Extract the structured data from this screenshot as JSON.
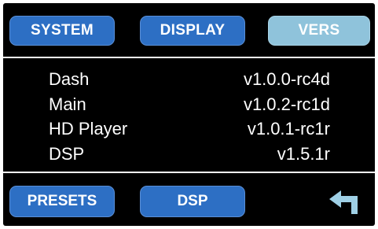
{
  "tabs": [
    {
      "label": "SYSTEM",
      "active": false
    },
    {
      "label": "DISPLAY",
      "active": false
    },
    {
      "label": "VERS",
      "active": true
    }
  ],
  "versions": [
    {
      "name": "Dash",
      "value": "v1.0.0-rc4d"
    },
    {
      "name": "Main",
      "value": "v1.0.2-rc1d"
    },
    {
      "name": "HD Player",
      "value": "v1.0.1-rc1r"
    },
    {
      "name": "DSP",
      "value": "v1.5.1r"
    }
  ],
  "bottom_bar": {
    "presets_label": "PRESETS",
    "dsp_label": "DSP",
    "back_icon": "return-arrow-icon"
  },
  "colors": {
    "background": "#000000",
    "button_blue": "#2d6fc4",
    "active_tab": "#8fc3db",
    "text": "#ffffff",
    "back_arrow": "#9fd0e6"
  }
}
